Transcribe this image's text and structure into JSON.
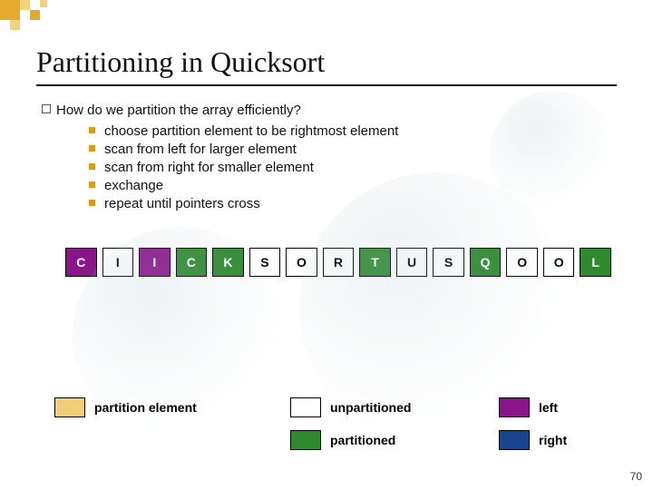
{
  "title": "Partitioning in Quicksort",
  "lead": "How do we partition the array efficiently?",
  "bullets": [
    "choose partition element to be rightmost element",
    "scan from left for larger element",
    "scan from right for smaller element",
    "exchange",
    "repeat until pointers cross"
  ],
  "array": [
    {
      "v": "C",
      "cls": "purple"
    },
    {
      "v": "I",
      "cls": ""
    },
    {
      "v": "I",
      "cls": "purple"
    },
    {
      "v": "C",
      "cls": "green"
    },
    {
      "v": "K",
      "cls": "green"
    },
    {
      "v": "S",
      "cls": ""
    },
    {
      "v": "O",
      "cls": ""
    },
    {
      "v": "R",
      "cls": ""
    },
    {
      "v": "T",
      "cls": "green"
    },
    {
      "v": "U",
      "cls": ""
    },
    {
      "v": "S",
      "cls": ""
    },
    {
      "v": "Q",
      "cls": "green"
    },
    {
      "v": "O",
      "cls": ""
    },
    {
      "v": "O",
      "cls": ""
    },
    {
      "v": "L",
      "cls": "green"
    }
  ],
  "legend": {
    "partition_element": "partition element",
    "unpartitioned": "unpartitioned",
    "partitioned": "partitioned",
    "left": "left",
    "right": "right"
  },
  "page": "70",
  "colors": {
    "purple": "#8a148a",
    "green": "#2f8a2f",
    "partition_swatch": "#f2ce79",
    "right_swatch": "#17458f",
    "accent": "#e3aa2e"
  }
}
